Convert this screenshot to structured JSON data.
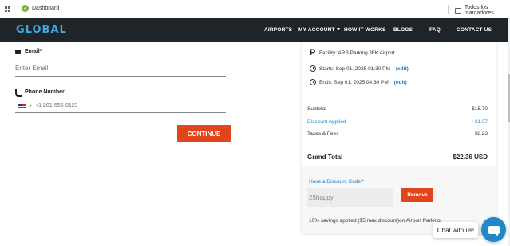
{
  "browser": {
    "bookmark_dashboard": "Dashboard",
    "bookmark_all": "Todos los marcadores"
  },
  "navbar": {
    "logo": "GLOBAL",
    "items": [
      {
        "label": "AIRPORTS"
      },
      {
        "label": "MY ACCOUNT"
      },
      {
        "label": "HOW IT WORKS"
      },
      {
        "label": "BLOGS"
      },
      {
        "label": "FAQ"
      },
      {
        "label": "CONTACT US"
      }
    ]
  },
  "form": {
    "email_label": "Email*",
    "email_placeholder": "Enter Email",
    "phone_label": "Phone Number",
    "phone_placeholder": "+1 201-555-0123",
    "continue_label": "CONTINUE"
  },
  "summary": {
    "facility": "Facility: ARB Parking JFK Airport",
    "starts": "Starts: Sep 01, 2025 01:30 PM",
    "ends": "Ends: Sep 01, 2025 04:30 PM",
    "edit_label": "(edit)",
    "subtotal_label": "Subtotal",
    "subtotal_value": "$15.70",
    "discount_label": "Discount Applied",
    "discount_value": "- $1.57",
    "fees_label": "Taxes & Fees",
    "fees_value": "$8.23",
    "grand_label": "Grand Total",
    "grand_value": "$22.36 USD",
    "promo_title": "Have a Discount Code?",
    "promo_code": "25happy",
    "remove_label": "Remove",
    "savings_note": "10% savings applied ($5 max discount)on Airport Parking"
  },
  "chat": {
    "label": "Chat with us!"
  },
  "colors": {
    "navbar": "#1f2429",
    "accent": "#e0451c",
    "link": "#1e7bc4",
    "logo": "#3fa9e0"
  }
}
